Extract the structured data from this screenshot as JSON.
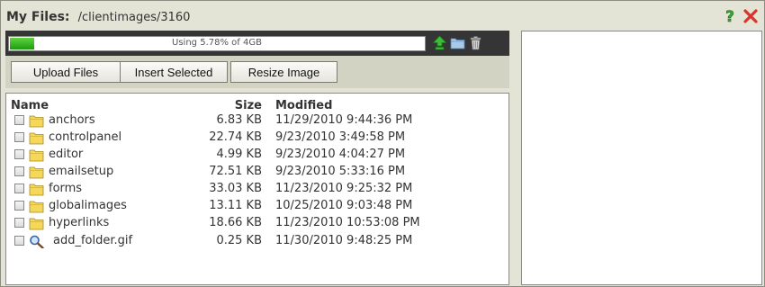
{
  "header": {
    "label": "My Files:",
    "path": "/clientimages/3160"
  },
  "storage": {
    "usage_text": "Using 5.78% of 4GB",
    "percent_used": 5.78
  },
  "buttons": {
    "upload": "Upload Files",
    "insert": "Insert Selected",
    "resize": "Resize Image"
  },
  "columns": {
    "name": "Name",
    "size": "Size",
    "modified": "Modified"
  },
  "files": [
    {
      "name": "anchors",
      "size": "6.83 KB",
      "modified": "11/29/2010 9:44:36 PM",
      "icon": "folder-icon"
    },
    {
      "name": "controlpanel",
      "size": "22.74 KB",
      "modified": "9/23/2010 3:49:58 PM",
      "icon": "folder-icon"
    },
    {
      "name": "editor",
      "size": "4.99 KB",
      "modified": "9/23/2010 4:04:27 PM",
      "icon": "folder-icon"
    },
    {
      "name": "emailsetup",
      "size": "72.51 KB",
      "modified": "9/23/2010 5:33:16 PM",
      "icon": "folder-icon"
    },
    {
      "name": "forms",
      "size": "33.03 KB",
      "modified": "11/23/2010 9:25:32 PM",
      "icon": "folder-icon"
    },
    {
      "name": "globalimages",
      "size": "13.11 KB",
      "modified": "10/25/2010 9:03:48 PM",
      "icon": "folder-icon"
    },
    {
      "name": "hyperlinks",
      "size": "18.66 KB",
      "modified": "11/23/2010 10:53:08 PM",
      "icon": "folder-icon"
    },
    {
      "name": "add_folder.gif",
      "size": "0.25 KB",
      "modified": "11/30/2010 9:48:25 PM",
      "icon": "magnifier-icon"
    }
  ],
  "colors": {
    "toolbar_bg": "#353535",
    "progress_green": "#2fb21f",
    "folder_yellow": "#f5d75a",
    "help_green": "#3aa834",
    "close_red": "#d9342b"
  }
}
